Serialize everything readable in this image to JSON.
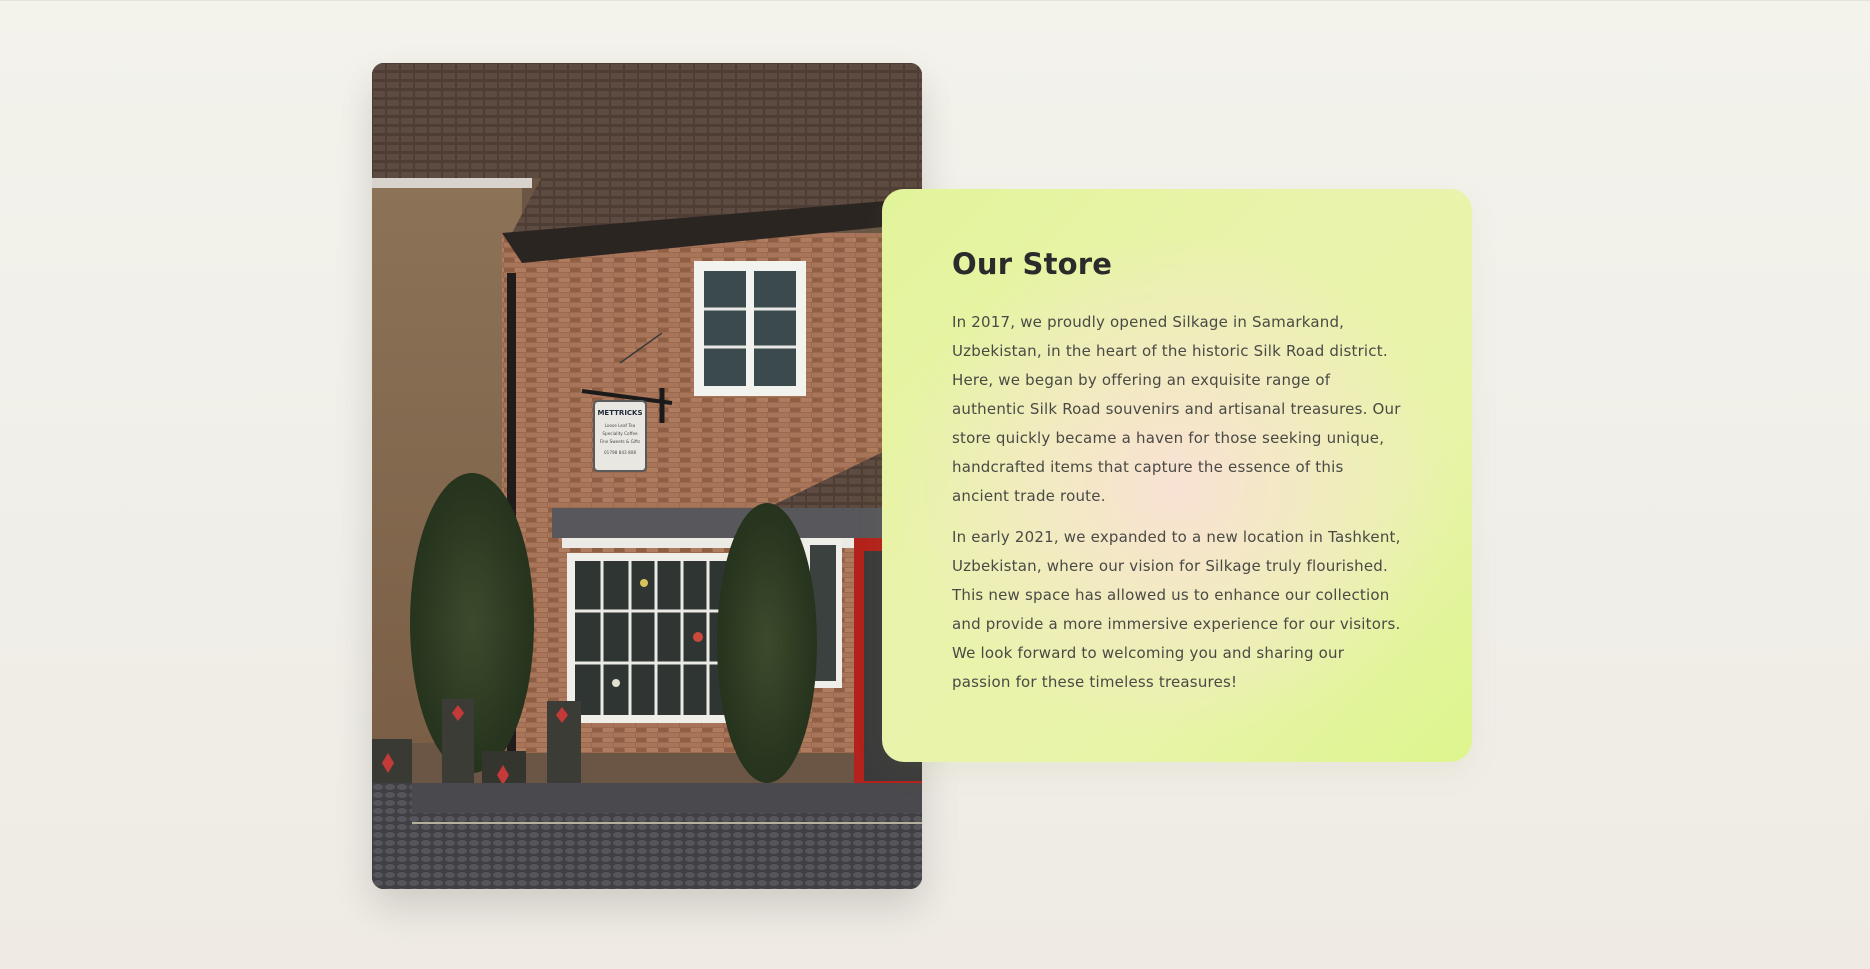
{
  "story": {
    "image": {
      "alt": "Brick shop front with hanging sign",
      "sign_lines": [
        "METTRICKS",
        "Loose Leaf Tea",
        "Speciality Coffee",
        "Fine Sweets & Gifts",
        "01798 843 808"
      ]
    },
    "card": {
      "title": "Our Store",
      "paragraphs": [
        "In 2017, we proudly opened Silkage in Samarkand, Uzbekistan, in the heart of the historic Silk Road district. Here, we began by offering an exquisite range of authentic Silk Road souvenirs and artisanal treasures. Our store quickly became a haven for those seeking unique, handcrafted items that capture the essence of this ancient trade route.",
        "In early 2021, we expanded to a new location in Tashkent, Uzbekistan, where our vision for Silkage truly flourished. This new space has allowed us to enhance our collection and provide a more immersive experience for our visitors. We look forward to welcoming you and sharing our passion for these timeless treasures!"
      ]
    },
    "colors": {
      "page_background": "#f1efe9",
      "card_green": "#e2f49a",
      "card_pink": "#fae0d6",
      "title_text": "#2b2b2b",
      "body_text": "#4a4a45"
    }
  }
}
